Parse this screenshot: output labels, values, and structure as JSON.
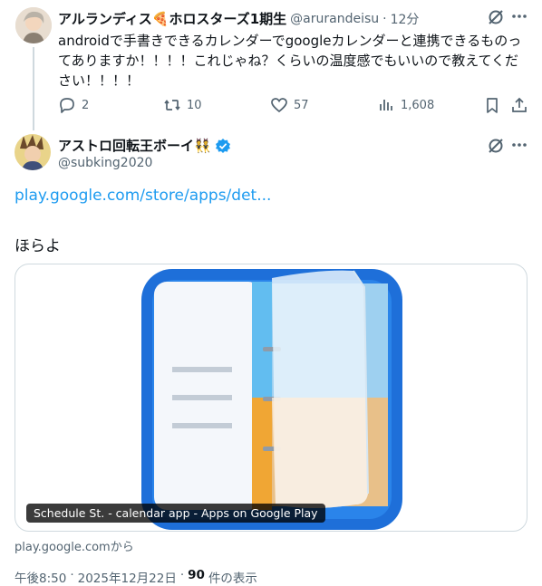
{
  "reply_parent": {
    "display_name": "アルランディス🍕ホロスターズ1期生",
    "handle": "@arurandeisu",
    "time": "12分",
    "text": "androidで手書きできるカレンダーでgoogleカレンダーと連携できるものってありますか！！！！これじゃね？くらいの温度感でもいいので教えてください！！！！",
    "stats": {
      "replies": "2",
      "retweets": "10",
      "likes": "57",
      "views": "1,608"
    }
  },
  "main_tweet": {
    "display_name": "アストロ回転王ボーイ👯",
    "handle": "@subking2020",
    "link_text": "play.google.com/store/apps/det...",
    "text": "ほらよ",
    "card": {
      "caption": "Schedule St. - calendar app - Apps on Google Play",
      "source": "play.google.comから"
    },
    "meta": {
      "time": "午後8:50",
      "date": "2025年12月22日",
      "views_count": "90",
      "views_label": "件の表示"
    }
  },
  "colors": {
    "link": "#1d9bf0",
    "secondary": "#536471",
    "verified": "#1d9bf0"
  }
}
